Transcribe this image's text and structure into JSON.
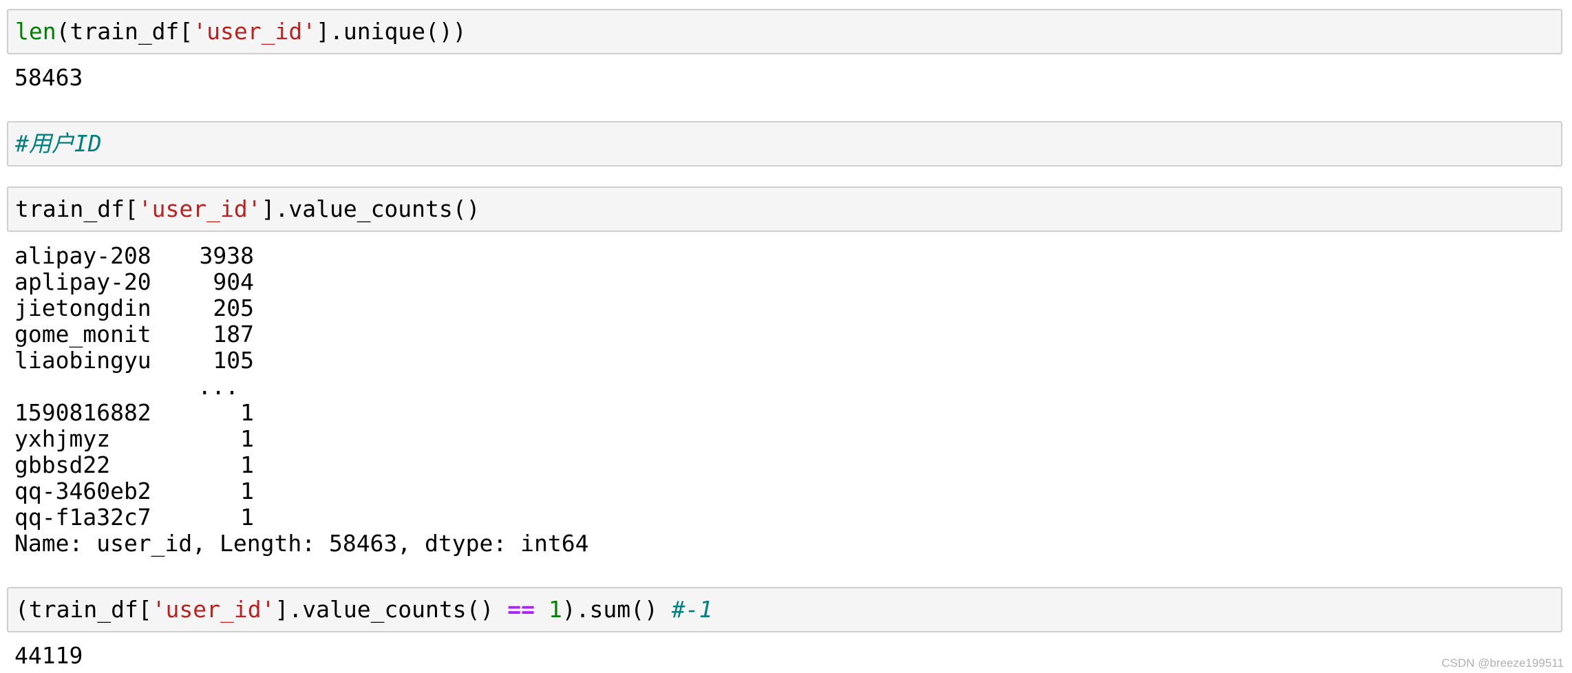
{
  "cells": {
    "c1": {
      "input": {
        "fn": "len",
        "pre": "(train_df[",
        "str": "'user_id'",
        "post": "].unique())"
      },
      "output": "58463"
    },
    "c2": {
      "input": {
        "comment": "#用户ID"
      }
    },
    "c3": {
      "input": {
        "pre": "train_df[",
        "str": "'user_id'",
        "post": "].value_counts()"
      },
      "output": {
        "rows": [
          {
            "index": "alipay-208",
            "value": "3938"
          },
          {
            "index": "aplipay-20",
            "value": "904"
          },
          {
            "index": "jietongdin",
            "value": "205"
          },
          {
            "index": "gome_monit",
            "value": "187"
          },
          {
            "index": "liaobingyu",
            "value": "105"
          },
          {
            "index": "",
            "value": "..."
          },
          {
            "index": "1590816882",
            "value": "1"
          },
          {
            "index": "yxhjmyz",
            "value": "1"
          },
          {
            "index": "gbbsd22",
            "value": "1"
          },
          {
            "index": "qq-3460eb2",
            "value": "1"
          },
          {
            "index": "qq-f1a32c7",
            "value": "1"
          }
        ],
        "footer": "Name: user_id, Length: 58463, dtype: int64"
      }
    },
    "c4": {
      "input": {
        "pre": "(train_df[",
        "str": "'user_id'",
        "mid": "].value_counts() ",
        "op": "==",
        "sp": " ",
        "num": "1",
        "post": ").sum() ",
        "comment": "#-1"
      },
      "output": "44119"
    }
  },
  "watermark": "CSDN @breeze199511"
}
